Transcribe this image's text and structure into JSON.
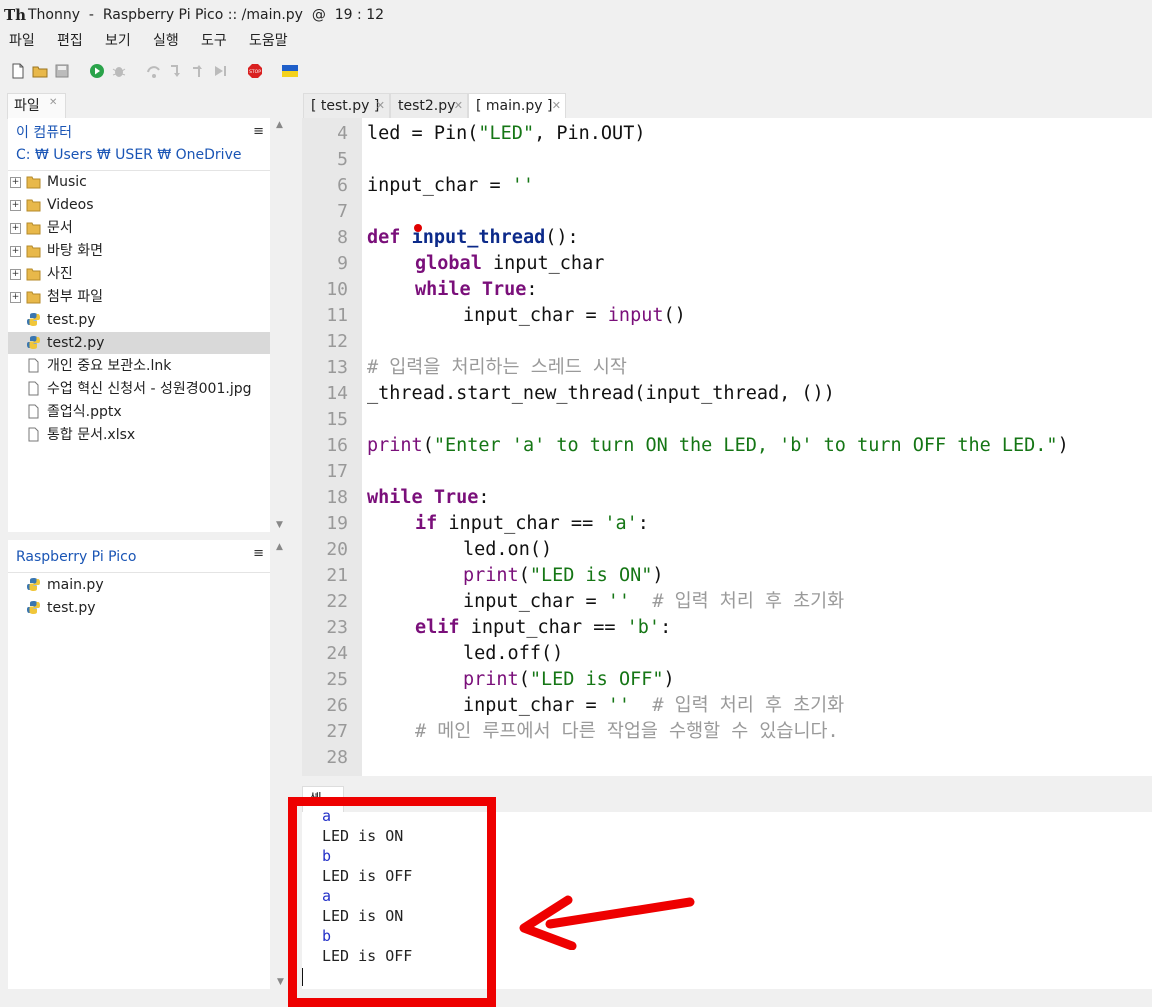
{
  "window": {
    "title": "Thonny  -  Raspberry Pi Pico :: /main.py  @  19 : 12",
    "app_icon": "Th"
  },
  "menu": [
    "파일",
    "편집",
    "보기",
    "실행",
    "도구",
    "도움말"
  ],
  "toolbar": [
    "new-file-icon",
    "open-folder-icon",
    "save-icon",
    "run-icon",
    "debug-icon",
    "step-over-icon",
    "step-into-icon",
    "step-out-icon",
    "resume-icon",
    "stop-icon",
    "ukraine-flag-icon"
  ],
  "files_tab": {
    "label": "파일"
  },
  "this_computer": {
    "title": "이 컴퓨터",
    "path": "C: ₩ Users ₩ USER ₩ OneDrive",
    "items": [
      {
        "label": "Music",
        "type": "folder"
      },
      {
        "label": "Videos",
        "type": "folder"
      },
      {
        "label": "문서",
        "type": "folder"
      },
      {
        "label": "바탕 화면",
        "type": "folder"
      },
      {
        "label": "사진",
        "type": "folder"
      },
      {
        "label": "첨부 파일",
        "type": "folder"
      },
      {
        "label": "test.py",
        "type": "python"
      },
      {
        "label": "test2.py",
        "type": "python",
        "selected": true
      },
      {
        "label": "개인 중요 보관소.lnk",
        "type": "file"
      },
      {
        "label": "수업 혁신 신청서 - 성원경001.jpg",
        "type": "file"
      },
      {
        "label": "졸업식.pptx",
        "type": "file"
      },
      {
        "label": "통합 문서.xlsx",
        "type": "file"
      }
    ]
  },
  "pico": {
    "title": "Raspberry Pi Pico",
    "items": [
      {
        "label": "main.py",
        "type": "python"
      },
      {
        "label": "test.py",
        "type": "python"
      }
    ]
  },
  "editor_tabs": [
    {
      "label": "[ test.py ]",
      "active": false
    },
    {
      "label": "test2.py",
      "active": false
    },
    {
      "label": "[ main.py ]",
      "active": true
    }
  ],
  "line_numbers": [
    "4",
    "5",
    "6",
    "7",
    "8",
    "9",
    "10",
    "11",
    "12",
    "13",
    "14",
    "15",
    "16",
    "17",
    "18",
    "19",
    "20",
    "21",
    "22",
    "23",
    "24",
    "25",
    "26",
    "27",
    "28"
  ],
  "code": {
    "l4a": "led = Pin(",
    "l4b": "\"LED\"",
    "l4c": ", Pin.OUT)",
    "l6a": "input_char = ",
    "l6b": "''",
    "l8a": "def",
    "l8b": "input_thread",
    "l8c": "():",
    "l9a": "global",
    "l9b": " input_char",
    "l10a": "while",
    "l10b": "True",
    "l10c": ":",
    "l11a": "input_char = ",
    "l11b": "input",
    "l11c": "()",
    "l13": "# 입력을 처리하는 스레드 시작",
    "l14": "_thread.start_new_thread(input_thread, ())",
    "l16a": "print",
    "l16b": "(",
    "l16c": "\"Enter 'a' to turn ON the LED, 'b' to turn OFF the LED.\"",
    "l16d": ")",
    "l18a": "while",
    "l18b": "True",
    "l18c": ":",
    "l19a": "if",
    "l19b": " input_char == ",
    "l19c": "'a'",
    "l19d": ":",
    "l20": "led.on()",
    "l21a": "print",
    "l21b": "(",
    "l21c": "\"LED is ON\"",
    "l21d": ")",
    "l22a": "input_char = ",
    "l22b": "''",
    "l22c": "  # 입력 처리 후 초기화",
    "l23a": "elif",
    "l23b": " input_char == ",
    "l23c": "'b'",
    "l23d": ":",
    "l24": "led.off()",
    "l25a": "print",
    "l25b": "(",
    "l25c": "\"LED is OFF\"",
    "l25d": ")",
    "l26a": "input_char = ",
    "l26b": "''",
    "l26c": "  # 입력 처리 후 초기화",
    "l27": "# 메인 루프에서 다른 작업을 수행할 수 있습니다."
  },
  "shell": {
    "tab_label": "셸",
    "lines": [
      {
        "text": "a",
        "kind": "in"
      },
      {
        "text": "LED is ON",
        "kind": "out"
      },
      {
        "text": "b",
        "kind": "in"
      },
      {
        "text": "LED is OFF",
        "kind": "out"
      },
      {
        "text": "a",
        "kind": "in"
      },
      {
        "text": "LED is ON",
        "kind": "out"
      },
      {
        "text": "b",
        "kind": "in"
      },
      {
        "text": "LED is OFF",
        "kind": "out"
      }
    ]
  },
  "colors": {
    "keyword": "#7a0f7a",
    "string": "#157615",
    "comment": "#9a9a9a",
    "shell_input": "#2330c8",
    "annotation": "#ee0000"
  }
}
